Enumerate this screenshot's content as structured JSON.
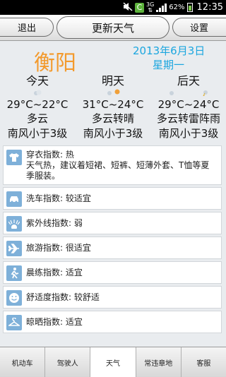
{
  "status_bar": {
    "signal_label": "3G",
    "battery": "62%",
    "time": "12:35"
  },
  "header": {
    "back_label": "退出",
    "title": "更新天气",
    "settings_label": "设置"
  },
  "weather": {
    "city": "衡阳",
    "date": "2013年6月3日",
    "weekday": "星期一",
    "days": [
      {
        "name": "今天",
        "temp": "29°C~22°C",
        "cond": "多云",
        "wind": "南风小于3级",
        "icon": "cloudy-icon"
      },
      {
        "name": "明天",
        "temp": "31°C~24°C",
        "cond": "多云转晴",
        "wind": "南风小于3级",
        "icon": "sunny-icon"
      },
      {
        "name": "后天",
        "temp": "29°C~24°C",
        "cond": "多云转雷阵雨",
        "wind": "南风小于3级",
        "icon": "thunder-icon"
      }
    ]
  },
  "indices": [
    {
      "label": "穿衣指数: 热",
      "detail": "天气热，建议着短裙、短裤、短薄外套、T恤等夏季服装。",
      "icon": "shirt-icon"
    },
    {
      "label": "洗车指数: 较适宜",
      "icon": "car-icon"
    },
    {
      "label": "紫外线指数: 弱",
      "icon": "sun-rays-icon"
    },
    {
      "label": "旅游指数: 很适宜",
      "icon": "airplane-icon"
    },
    {
      "label": "晨练指数: 适宜",
      "icon": "runner-icon"
    },
    {
      "label": "舒适度指数: 较舒适",
      "icon": "smiley-icon"
    },
    {
      "label": "晾晒指数: 适宜",
      "icon": "hanger-icon"
    }
  ],
  "tabs": [
    {
      "label": "机动车"
    },
    {
      "label": "驾驶人"
    },
    {
      "label": "天气",
      "active": true
    },
    {
      "label": "常违章地"
    },
    {
      "label": "客服"
    }
  ],
  "colors": {
    "city": "#f39a2d",
    "date": "#1ba6df",
    "icon_bg": "#7eb0d9"
  }
}
